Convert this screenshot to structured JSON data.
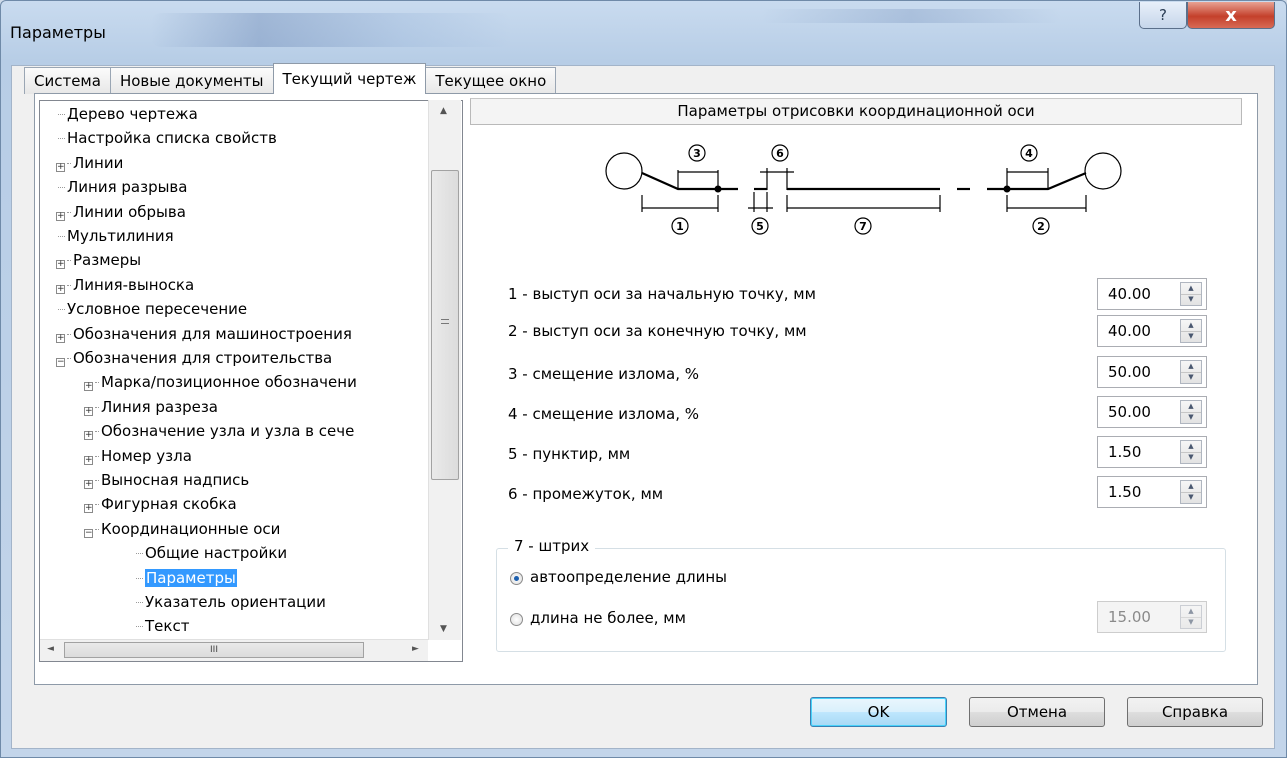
{
  "window": {
    "title": "Параметры",
    "help_glyph": "?",
    "close_glyph": "x"
  },
  "tabs": [
    {
      "label": "Система",
      "active": false
    },
    {
      "label": "Новые документы",
      "active": false
    },
    {
      "label": "Текущий чертеж",
      "active": true
    },
    {
      "label": "Текущее окно",
      "active": false
    }
  ],
  "tree": {
    "items": [
      {
        "label": "Дерево чертежа",
        "expander": "",
        "level": 0
      },
      {
        "label": "Настройка списка свойств",
        "expander": "",
        "level": 0
      },
      {
        "label": "Линии",
        "expander": "+",
        "level": 0
      },
      {
        "label": "Линия разрыва",
        "expander": "",
        "level": 0
      },
      {
        "label": "Линии обрыва",
        "expander": "+",
        "level": 0
      },
      {
        "label": "Мультилиния",
        "expander": "",
        "level": 0
      },
      {
        "label": "Размеры",
        "expander": "+",
        "level": 0
      },
      {
        "label": "Линия-выноска",
        "expander": "+",
        "level": 0
      },
      {
        "label": "Условное пересечение",
        "expander": "",
        "level": 0
      },
      {
        "label": "Обозначения для машиностроения",
        "expander": "+",
        "level": 0
      },
      {
        "label": "Обозначения для строительства",
        "expander": "−",
        "level": 0
      },
      {
        "label": "Марка/позиционное обозначени",
        "expander": "+",
        "level": 1
      },
      {
        "label": "Линия разреза",
        "expander": "+",
        "level": 1
      },
      {
        "label": "Обозначение узла и узла в сече",
        "expander": "+",
        "level": 1
      },
      {
        "label": "Номер узла",
        "expander": "+",
        "level": 1
      },
      {
        "label": "Выносная надпись",
        "expander": "+",
        "level": 1
      },
      {
        "label": "Фигурная скобка",
        "expander": "+",
        "level": 1
      },
      {
        "label": "Координационные оси",
        "expander": "−",
        "level": 1
      },
      {
        "label": "Общие настройки",
        "expander": "",
        "level": 2
      },
      {
        "label": "Параметры",
        "expander": "",
        "level": 2,
        "selected": true
      },
      {
        "label": "Указатель ориентации",
        "expander": "",
        "level": 2
      },
      {
        "label": "Текст",
        "expander": "",
        "level": 2
      }
    ],
    "hscroll_thumb_glyph": "III"
  },
  "panel": {
    "header": "Параметры отрисовки координационной оси",
    "diagram_labels": [
      "1",
      "2",
      "3",
      "4",
      "5",
      "6",
      "7"
    ],
    "params": [
      {
        "label": "1 - выступ оси за начальную точку, мм",
        "value": "40.00"
      },
      {
        "label": "2 - выступ оси за конечную точку, мм",
        "value": "40.00"
      },
      {
        "label": "3 - смещение излома, %",
        "value": "50.00"
      },
      {
        "label": "4 - смещение излома, %",
        "value": "50.00"
      },
      {
        "label": "5 - пунктир, мм",
        "value": "1.50"
      },
      {
        "label": "6 - промежуток, мм",
        "value": "1.50"
      }
    ],
    "stroke_group": {
      "title": "7 - штрих",
      "option_auto": "автоопределение длины",
      "option_max": "длина не более, мм",
      "selected": "auto",
      "max_value": "15.00"
    }
  },
  "buttons": {
    "ok": "OK",
    "cancel": "Отмена",
    "help": "Справка"
  }
}
